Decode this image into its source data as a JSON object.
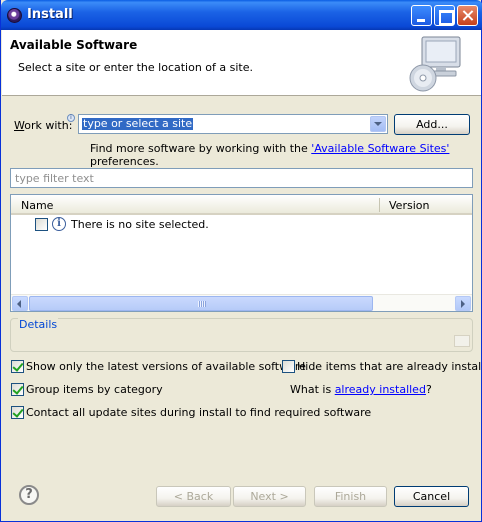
{
  "window": {
    "title": "Install"
  },
  "banner": {
    "title": "Available Software",
    "description": "Select a site or enter the location of a site."
  },
  "work_with": {
    "label": "Work with:",
    "combo_value": "type or select a site",
    "add_button": "Add..."
  },
  "more_software": {
    "prefix": "Find more software by working with the ",
    "link": "'Available Software Sites'",
    "suffix": " preferences."
  },
  "filter": {
    "placeholder": "type filter text"
  },
  "table": {
    "columns": [
      "Name",
      "Version"
    ],
    "rows": [
      {
        "name": "There is no site selected.",
        "version": ""
      }
    ]
  },
  "details": {
    "title": "Details"
  },
  "options": {
    "show_latest": {
      "label": "Show only the latest versions of available software",
      "checked": true
    },
    "hide_installed": {
      "label": "Hide items that are already installed",
      "checked": false
    },
    "group_by_category": {
      "label": "Group items by category",
      "checked": true
    },
    "contact_sites": {
      "label": "Contact all update sites during install to find required software",
      "checked": true
    }
  },
  "what_is": {
    "prefix": "What is ",
    "link": "already installed",
    "suffix": "?"
  },
  "footer": {
    "back": "< Back",
    "next": "Next >",
    "finish": "Finish",
    "cancel": "Cancel",
    "help": "?"
  }
}
